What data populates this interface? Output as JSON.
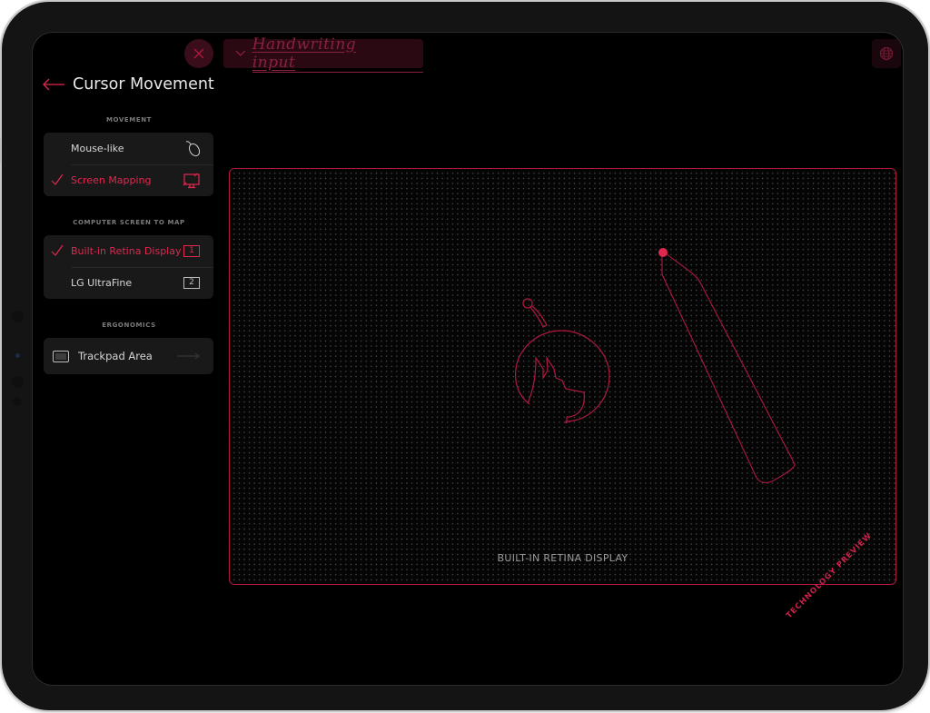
{
  "top_bar": {
    "close_icon": "close-icon",
    "handwriting_label": "Handwriting input",
    "handwriting_icon": "chevron-down-icon",
    "globe_icon": "globe-icon"
  },
  "header": {
    "back_icon": "arrow-left-icon",
    "title": "Cursor Movement"
  },
  "sections": {
    "movement": {
      "label": "MOVEMENT",
      "items": [
        {
          "label": "Mouse-like",
          "selected": false,
          "icon": "mouse-icon"
        },
        {
          "label": "Screen Mapping",
          "selected": true,
          "icon": "screen-mapping-icon"
        }
      ]
    },
    "screen_to_map": {
      "label": "COMPUTER SCREEN TO MAP",
      "items": [
        {
          "label": "Built-in Retina Display",
          "selected": true,
          "badge": "1"
        },
        {
          "label": "LG UltraFine",
          "selected": false,
          "badge": "2"
        }
      ]
    },
    "ergonomics": {
      "label": "ERGONOMICS",
      "items": [
        {
          "label": "Trackpad Area",
          "icon": "trackpad-icon",
          "action_icon": "arrow-right-icon"
        }
      ]
    }
  },
  "map": {
    "caption": "BUILT-IN RETINA DISPLAY",
    "logo_icon": "astronaut-dog-logo-icon",
    "pencil_icon": "pencil-icon"
  },
  "watermark": "TECHNOLOGY PREVIEW",
  "colors": {
    "accent": "#e0284f",
    "accent_dark": "#b0183f",
    "background": "#000000",
    "panel": "#191919",
    "text": "#d6d6d6"
  }
}
